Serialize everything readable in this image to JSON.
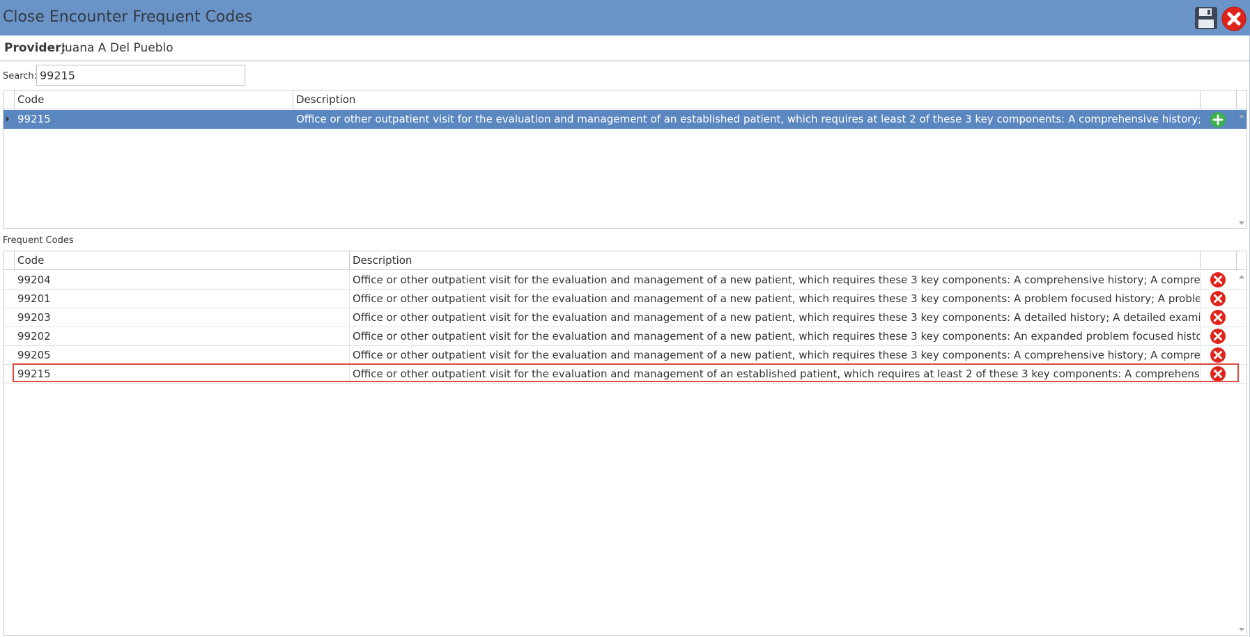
{
  "window": {
    "title": "Close Encounter Frequent Codes",
    "save_icon": "floppy-disk-save-icon",
    "close_icon": "red-x-close-icon"
  },
  "provider": {
    "label": "Provider:",
    "name": "Juana A Del Pueblo"
  },
  "search": {
    "label": "Search:",
    "value": "99215"
  },
  "search_results": {
    "columns": {
      "code": "Code",
      "description": "Description"
    },
    "rows": [
      {
        "code": "99215",
        "description": "Office or other outpatient visit for the evaluation and management of an established patient, which requires at least 2 of these 3 key components: A comprehensive history; A compr...",
        "action_icon": "green-plus-add-icon",
        "selected": true
      }
    ]
  },
  "frequent_codes": {
    "section_label": "Frequent Codes",
    "columns": {
      "code": "Code",
      "description": "Description"
    },
    "rows": [
      {
        "code": "99204",
        "description": "Office or other outpatient visit for the evaluation and management of a new patient, which requires these 3 key components: A comprehensive history; A comprehensive...",
        "action_icon": "red-x-remove-icon"
      },
      {
        "code": "99201",
        "description": "Office or other outpatient visit for the evaluation and management of a new patient, which requires these 3 key components: A problem focused history; A problem focus...",
        "action_icon": "red-x-remove-icon"
      },
      {
        "code": "99203",
        "description": "Office or other outpatient visit for the evaluation and management of a new patient, which requires these 3 key components: A detailed history; A detailed examination;...",
        "action_icon": "red-x-remove-icon"
      },
      {
        "code": "99202",
        "description": "Office or other outpatient visit for the evaluation and management of a new patient, which requires these 3 key components: An expanded problem focused history; An e...",
        "action_icon": "red-x-remove-icon"
      },
      {
        "code": "99205",
        "description": "Office or other outpatient visit for the evaluation and management of a new patient, which requires these 3 key components: A comprehensive history; A comprehensive...",
        "action_icon": "red-x-remove-icon"
      },
      {
        "code": "99215",
        "description": "Office or other outpatient visit for the evaluation and management of an established patient, which requires at least 2 of these 3 key components: A comprehensive histor...",
        "action_icon": "red-x-remove-icon",
        "highlighted": true
      }
    ]
  },
  "colors": {
    "titlebar": "#6a94c8",
    "selected_row": "#5a87bf",
    "add_green": "#3cb34a",
    "remove_red": "#e0241b",
    "highlight_border": "#e0483e"
  }
}
